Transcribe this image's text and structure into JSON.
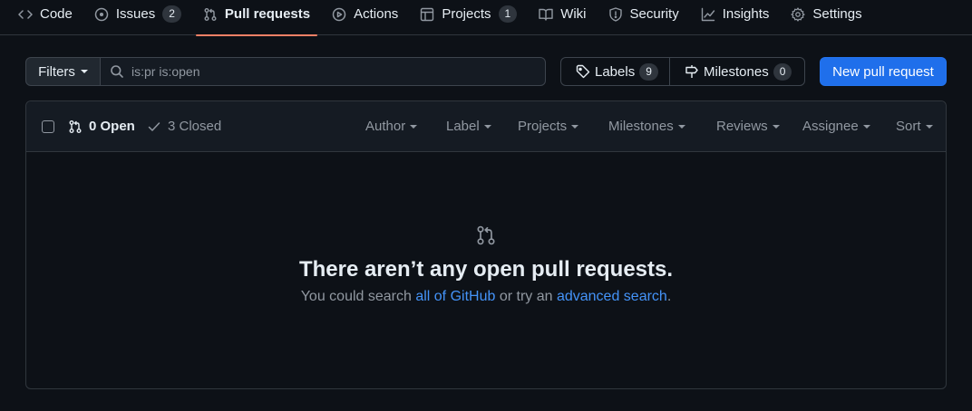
{
  "nav": {
    "tabs": [
      {
        "label": "Code",
        "icon": "code-icon"
      },
      {
        "label": "Issues",
        "icon": "issue-opened-icon",
        "count": "2"
      },
      {
        "label": "Pull requests",
        "icon": "git-pull-request-icon",
        "selected": true
      },
      {
        "label": "Actions",
        "icon": "play-icon"
      },
      {
        "label": "Projects",
        "icon": "table-icon",
        "count": "1"
      },
      {
        "label": "Wiki",
        "icon": "book-icon"
      },
      {
        "label": "Security",
        "icon": "shield-icon"
      },
      {
        "label": "Insights",
        "icon": "graph-icon"
      },
      {
        "label": "Settings",
        "icon": "gear-icon"
      }
    ]
  },
  "toolbar": {
    "filters_label": "Filters",
    "search_value": "is:pr is:open",
    "labels_label": "Labels",
    "labels_count": "9",
    "milestones_label": "Milestones",
    "milestones_count": "0",
    "new_pr_label": "New pull request"
  },
  "list_header": {
    "open_label": "0 Open",
    "closed_label": "3 Closed",
    "filters": [
      "Author",
      "Label",
      "Projects",
      "Milestones",
      "Reviews",
      "Assignee",
      "Sort"
    ]
  },
  "empty_state": {
    "title": "There aren’t any open pull requests.",
    "desc_prefix": "You could search ",
    "link1": "all of GitHub",
    "desc_middle": " or try an ",
    "link2": "advanced search",
    "desc_suffix": "."
  },
  "colors": {
    "background": "#0d1117",
    "accent_blue": "#1f6feb",
    "link": "#4493f8",
    "selected_underline": "#f78166"
  }
}
